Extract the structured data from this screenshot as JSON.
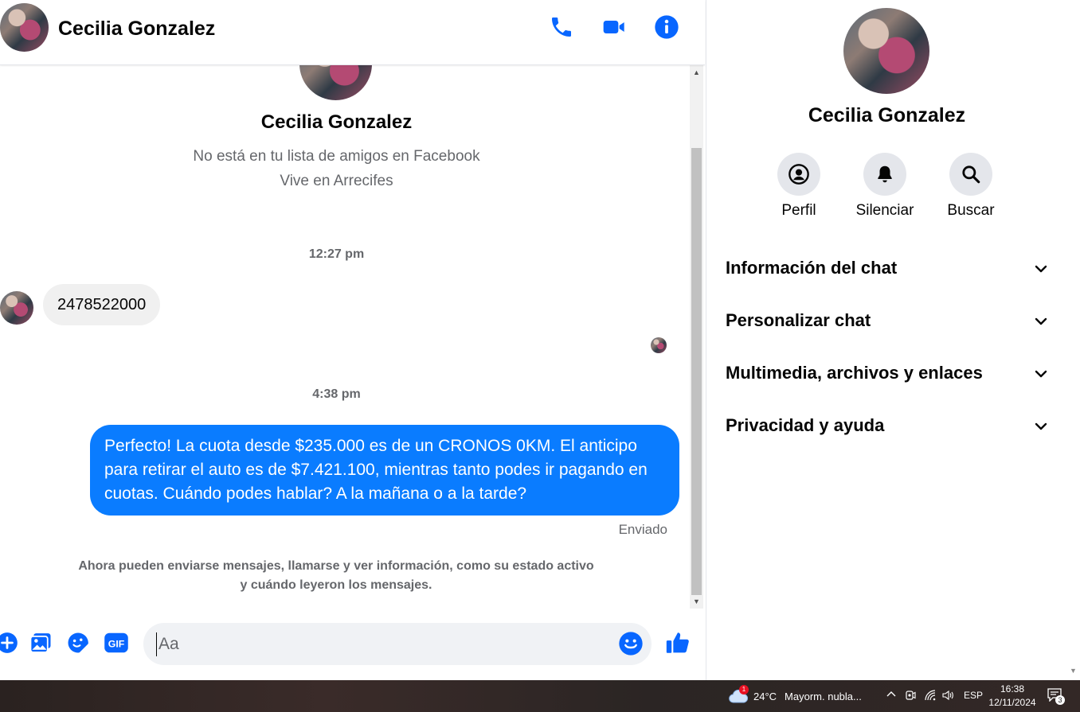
{
  "header": {
    "contact_name": "Cecilia Gonzalez",
    "icons": [
      "phone-icon",
      "video-camera-icon",
      "info-icon"
    ]
  },
  "conversation": {
    "intro": {
      "name": "Cecilia Gonzalez",
      "friend_status": "No está en tu lista de amigos en Facebook",
      "location": "Vive en Arrecifes"
    },
    "messages": [
      {
        "time": "12:27 pm",
        "direction": "incoming",
        "text": "2478522000"
      },
      {
        "time": "4:38 pm",
        "direction": "outgoing",
        "text": "Perfecto! La cuota desde $235.000 es de un CRONOS 0KM. El anticipo para retirar el auto es de $7.421.100, mientras tanto podes ir pagando en cuotas. Cuándo podes hablar? A la mañana o a la tarde?"
      }
    ],
    "sent_status": "Enviado",
    "notice": "Ahora pueden enviarse mensajes, llamarse y ver información, como su estado activo y cuándo leyeron los mensajes."
  },
  "composer": {
    "placeholder": "Aa",
    "value": "",
    "icons": [
      "plus-icon",
      "photo-icon",
      "sticker-icon",
      "gif-icon",
      "emoji-icon",
      "like-icon"
    ]
  },
  "panel": {
    "name": "Cecilia Gonzalez",
    "actions": [
      {
        "label": "Perfil",
        "icon": "profile-icon"
      },
      {
        "label": "Silenciar",
        "icon": "bell-icon"
      },
      {
        "label": "Buscar",
        "icon": "search-icon"
      }
    ],
    "sections": [
      {
        "label": "Información del chat"
      },
      {
        "label": "Personalizar chat"
      },
      {
        "label": "Multimedia, archivos y enlaces"
      },
      {
        "label": "Privacidad y ayuda"
      }
    ]
  },
  "taskbar": {
    "weather": {
      "badge": "1",
      "temp": "24°C",
      "condition": "Mayorm. nubla..."
    },
    "language": "ESP",
    "time": "16:38",
    "date": "12/11/2024",
    "notifications": "3"
  },
  "colors": {
    "accent": "#0a7cff",
    "icon_blue": "#0866ff",
    "incoming_bubble": "#f0f0f0",
    "secondary_text": "#65676b"
  }
}
